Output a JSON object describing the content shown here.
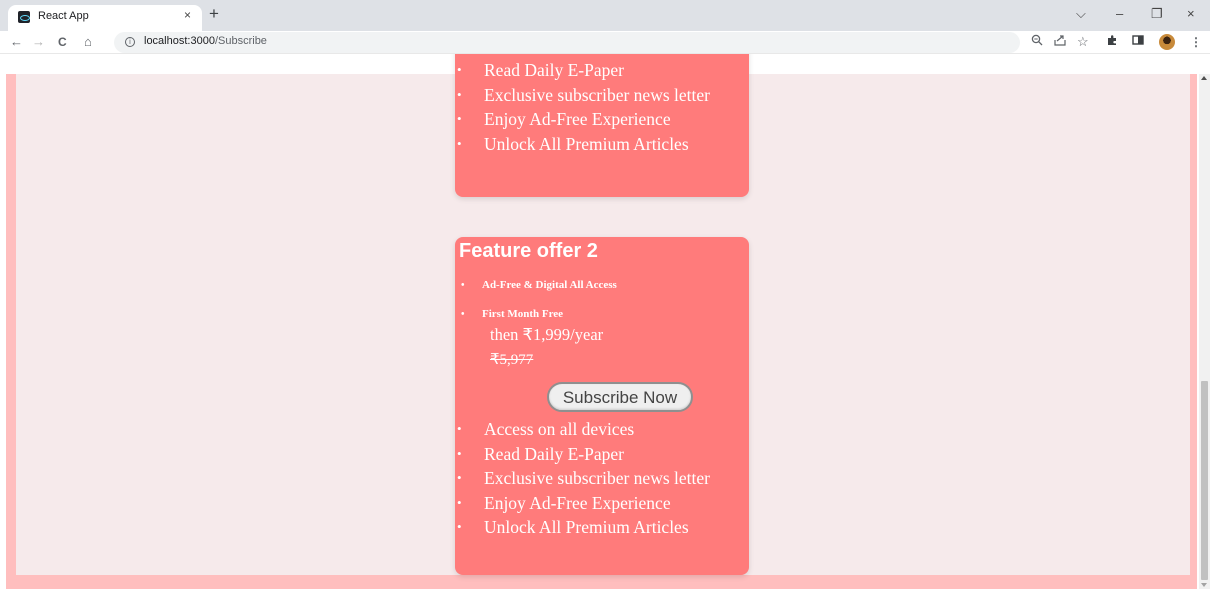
{
  "browser": {
    "tab_title": "React App",
    "tab_close": "×",
    "new_tab": "+",
    "controls": {
      "dropdown": "⌵",
      "minimize": "–",
      "restore": "❐",
      "close": "×"
    },
    "nav": {
      "back": "←",
      "forward": "→",
      "reload": "C",
      "home": "⌂"
    },
    "url_host": "localhost:3000",
    "url_path": "/Subscribe",
    "toolbar_icons": [
      "zoom-icon",
      "share-icon",
      "bookmark-star-icon",
      "extensions-icon",
      "side-panel-icon",
      "profile-avatar",
      "menu-icon"
    ]
  },
  "card1": {
    "features": [
      "Read Daily E-Paper",
      "Exclusive subscriber news letter",
      "Enjoy Ad-Free Experience",
      "Unlock All Premium Articles"
    ]
  },
  "card2": {
    "title": "Feature offer 2",
    "offers": [
      "Ad-Free & Digital All Access",
      "First Month Free"
    ],
    "price": "then ₹1,999/year",
    "old_price": "₹5,977",
    "button_label": "Subscribe Now",
    "features": [
      "Access on all devices",
      "Read Daily E-Paper",
      "Exclusive subscriber news letter",
      "Enjoy Ad-Free Experience",
      "Unlock All Premium Articles"
    ]
  },
  "colors": {
    "card": "#ff7b7b",
    "page": "#f6eaeb",
    "border": "#ffbebe"
  }
}
